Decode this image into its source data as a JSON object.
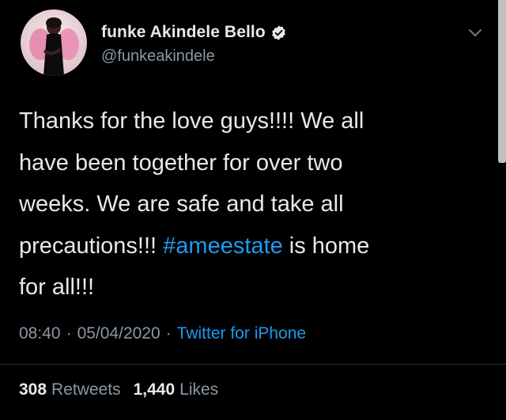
{
  "tweet": {
    "author": {
      "display_name": "funke Akindele Bello",
      "handle": "@funkeakindele",
      "verified": true,
      "verified_badge_icon": "verified-badge-icon",
      "avatar_icon": "avatar-photo"
    },
    "menu_icon": "chevron-down-icon",
    "text_before_hashtag": "Thanks for the love guys!!!! We all\nhave been together for over two\nweeks. We are safe and take all\nprecautions!!! ",
    "hashtag": "#ameestate",
    "text_after_hashtag": " is home\nfor all!!!",
    "time": "08:40",
    "separator": "·",
    "date": "05/04/2020",
    "source": "Twitter for iPhone",
    "retweets_count": "308",
    "retweets_label": "Retweets",
    "likes_count": "1,440",
    "likes_label": "Likes"
  },
  "colors": {
    "background": "#000000",
    "text_primary": "#e7e9ea",
    "text_secondary": "#8b98a5",
    "link_blue": "#1d9bf0"
  }
}
